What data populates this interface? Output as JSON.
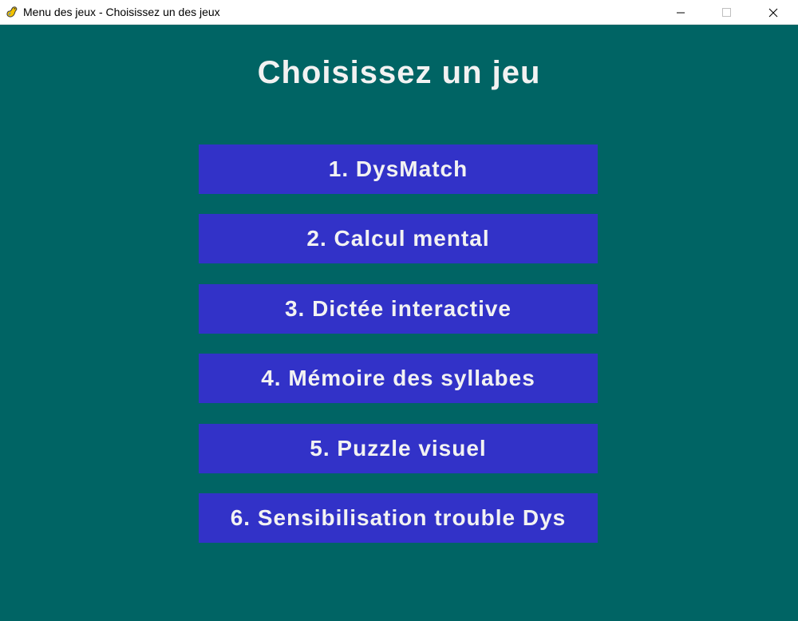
{
  "window": {
    "title": "Menu des jeux - Choisissez un des jeux",
    "icon": "pygame-snake-icon"
  },
  "heading": "Choisissez un jeu",
  "menu": {
    "items": [
      {
        "label": "1. DysMatch"
      },
      {
        "label": "2. Calcul mental"
      },
      {
        "label": "3. Dictée interactive"
      },
      {
        "label": "4. Mémoire des syllabes"
      },
      {
        "label": "5. Puzzle visuel"
      },
      {
        "label": "6. Sensibilisation trouble Dys"
      }
    ]
  },
  "colors": {
    "background": "#006464",
    "button": "#3232c8",
    "text": "#f2f2f2"
  }
}
